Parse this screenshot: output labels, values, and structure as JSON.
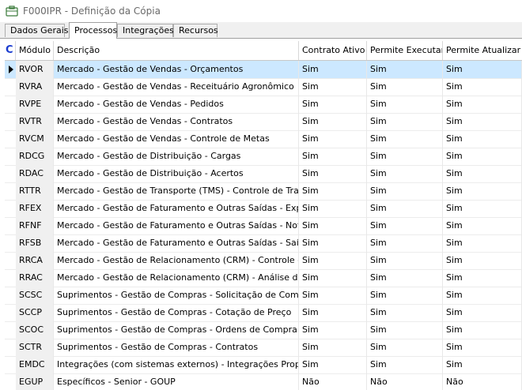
{
  "window": {
    "title": "F000IPR - Definição da Cópia",
    "icon": "briefcase-icon"
  },
  "tabs": [
    {
      "label": "Dados Gerais",
      "active": false
    },
    {
      "label": "Processos",
      "active": true
    },
    {
      "label": "Integrações",
      "active": false
    },
    {
      "label": "Recursos",
      "active": false
    }
  ],
  "grid": {
    "corner": "C",
    "columns": {
      "modulo": "Módulo",
      "descricao": "Descrição",
      "contrato": "Contrato Ativo",
      "executar": "Permite Executar",
      "atualizar": "Permite Atualizar"
    },
    "rows": [
      {
        "mod": "RVOR",
        "desc": "Mercado - Gestão de Vendas - Orçamentos",
        "ca": "Sim",
        "pe": "Sim",
        "pa": "Sim",
        "selected": true
      },
      {
        "mod": "RVRA",
        "desc": "Mercado - Gestão de Vendas - Receituário Agronômico",
        "ca": "Sim",
        "pe": "Sim",
        "pa": "Sim"
      },
      {
        "mod": "RVPE",
        "desc": "Mercado - Gestão de Vendas - Pedidos",
        "ca": "Sim",
        "pe": "Sim",
        "pa": "Sim"
      },
      {
        "mod": "RVTR",
        "desc": "Mercado - Gestão de Vendas - Contratos",
        "ca": "Sim",
        "pe": "Sim",
        "pa": "Sim"
      },
      {
        "mod": "RVCM",
        "desc": "Mercado - Gestão de Vendas - Controle de Metas",
        "ca": "Sim",
        "pe": "Sim",
        "pa": "Sim"
      },
      {
        "mod": "RDCG",
        "desc": "Mercado - Gestão de Distribuição - Cargas",
        "ca": "Sim",
        "pe": "Sim",
        "pa": "Sim"
      },
      {
        "mod": "RDAC",
        "desc": "Mercado - Gestão de Distribuição - Acertos",
        "ca": "Sim",
        "pe": "Sim",
        "pa": "Sim"
      },
      {
        "mod": "RTTR",
        "desc": "Mercado - Gestão de Transporte (TMS) - Controle de Transpo",
        "ca": "Sim",
        "pe": "Sim",
        "pa": "Sim"
      },
      {
        "mod": "RFEX",
        "desc": "Mercado - Gestão de Faturamento e Outras Saídas - Expedi",
        "ca": "Sim",
        "pe": "Sim",
        "pa": "Sim"
      },
      {
        "mod": "RFNF",
        "desc": "Mercado - Gestão de Faturamento e Outras Saídas - Notas F",
        "ca": "Sim",
        "pe": "Sim",
        "pa": "Sim"
      },
      {
        "mod": "RFSB",
        "desc": "Mercado - Gestão de Faturamento e Outras Saídas - Saída v",
        "ca": "Sim",
        "pe": "Sim",
        "pa": "Sim"
      },
      {
        "mod": "RRCA",
        "desc": "Mercado - Gestão de Relacionamento (CRM) - Controle de A",
        "ca": "Sim",
        "pe": "Sim",
        "pa": "Sim"
      },
      {
        "mod": "RRAC",
        "desc": "Mercado - Gestão de Relacionamento (CRM) - Análise de Cre",
        "ca": "Sim",
        "pe": "Sim",
        "pa": "Sim"
      },
      {
        "mod": "SCSC",
        "desc": "Suprimentos - Gestão de Compras - Solicitação de Compra",
        "ca": "Sim",
        "pe": "Sim",
        "pa": "Sim"
      },
      {
        "mod": "SCCP",
        "desc": "Suprimentos - Gestão de Compras - Cotação de Preço",
        "ca": "Sim",
        "pe": "Sim",
        "pa": "Sim"
      },
      {
        "mod": "SCOC",
        "desc": "Suprimentos - Gestão de Compras - Ordens de Compra",
        "ca": "Sim",
        "pe": "Sim",
        "pa": "Sim"
      },
      {
        "mod": "SCTR",
        "desc": "Suprimentos - Gestão de Compras - Contratos",
        "ca": "Sim",
        "pe": "Sim",
        "pa": "Sim"
      },
      {
        "mod": "EMDC",
        "desc": "Integrações (com sistemas externos) - Integrações Proprietá",
        "ca": "Sim",
        "pe": "Sim",
        "pa": "Sim"
      },
      {
        "mod": "EGUP",
        "desc": "Específicos - Senior - GOUP",
        "ca": "Não",
        "pe": "Não",
        "pa": "Não"
      }
    ]
  }
}
